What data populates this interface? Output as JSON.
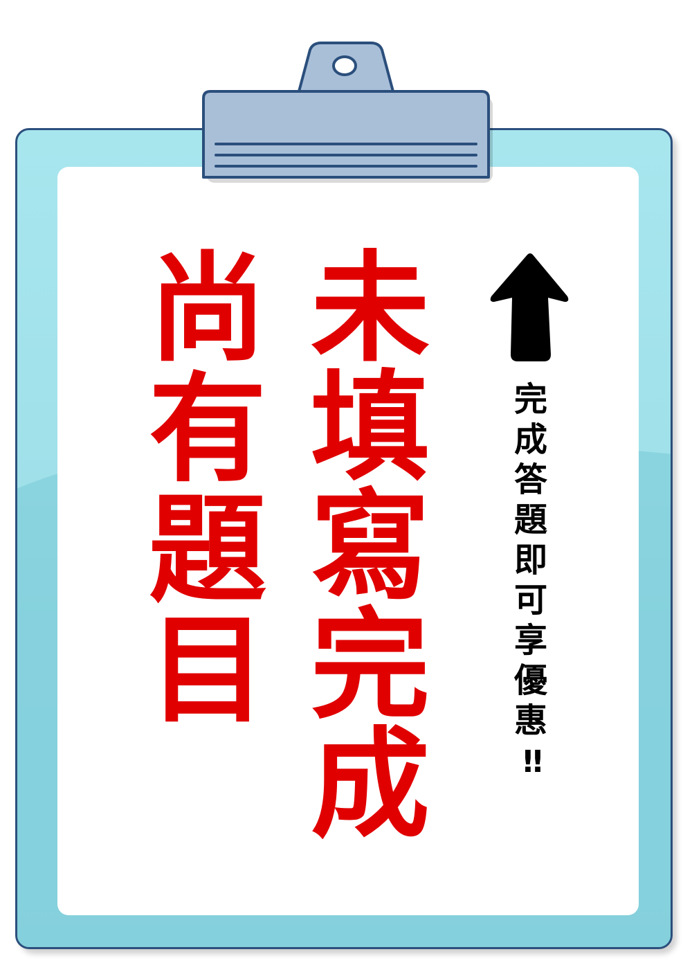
{
  "colors": {
    "board": "#9fe0e9",
    "board_dark": "#7ccbd8",
    "board_border": "#2b4f7c",
    "clip": "#a9bfd8",
    "title_red": "#e00000",
    "note_black": "#000000"
  },
  "sign": {
    "line1": [
      "未",
      "填",
      "寫",
      "完",
      "成"
    ],
    "line2": [
      "尚",
      "有",
      "題",
      "目"
    ],
    "note_chars": [
      "完",
      "成",
      "答",
      "題",
      "即",
      "可",
      "享",
      "優",
      "惠"
    ],
    "note_exclaim": "!!"
  },
  "icons": {
    "arrow": "up-arrow-icon",
    "clip": "clipboard-clip-icon"
  }
}
